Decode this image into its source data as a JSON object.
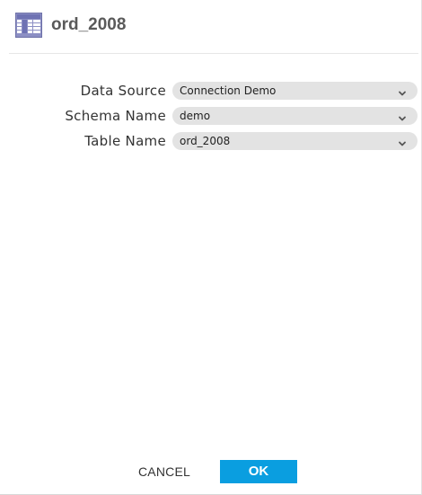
{
  "dialog": {
    "title": "ord_2008",
    "icon": "table-icon"
  },
  "form": {
    "fields": [
      {
        "label": "Data Source",
        "value": "Connection Demo",
        "icon": "chevron-down-icon"
      },
      {
        "label": "Schema Name",
        "value": "demo",
        "icon": "chevron-down-icon"
      },
      {
        "label": "Table Name",
        "value": "ord_2008",
        "icon": "chevron-down-icon"
      }
    ]
  },
  "footer": {
    "cancel_label": "CANCEL",
    "ok_label": "OK"
  },
  "colors": {
    "accent": "#0a9ee0",
    "select_background": "#e3e3e3",
    "title_text": "#5a5a5a"
  }
}
